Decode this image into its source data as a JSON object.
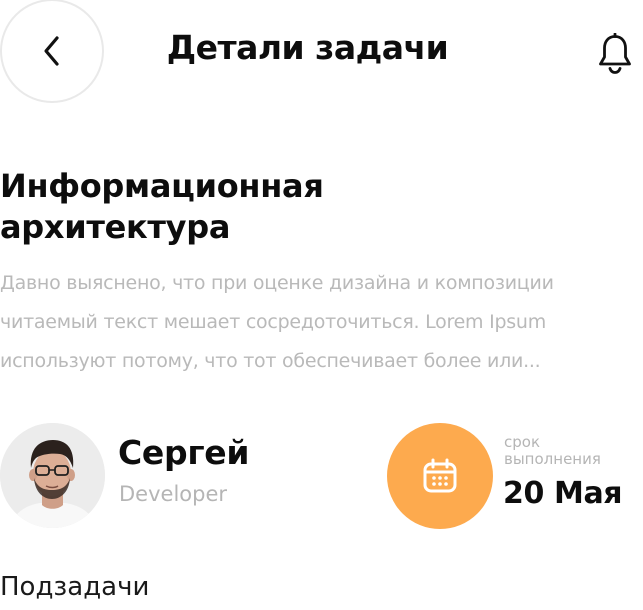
{
  "header": {
    "title": "Детали задачи",
    "back_icon": "chevron-left-icon",
    "notification_icon": "bell-icon"
  },
  "task": {
    "title_line1": "Информационная",
    "title_line2": "архитектура",
    "description_lines": [
      "Давно выяснено, что при оценке дизайна и композиции",
      "читаемый текст мешает сосредоточиться. Lorem Ipsum",
      "используют потому, что тот обеспечивает более или..."
    ]
  },
  "assignee": {
    "name": "Сергей",
    "role": "Developer"
  },
  "due": {
    "label_line1": "срок",
    "label_line2": "выполнения",
    "date": "20 Мая",
    "icon": "calendar-icon",
    "accent_color": "#FDAA4E"
  },
  "subtasks": {
    "heading": "Подзадачи"
  }
}
